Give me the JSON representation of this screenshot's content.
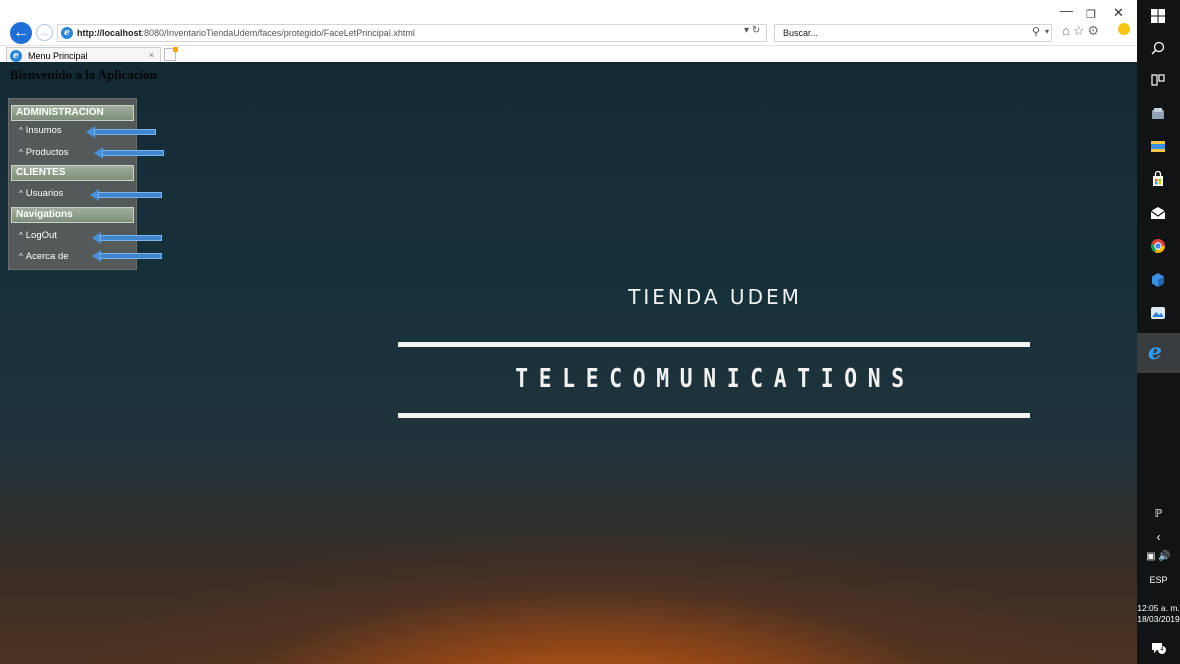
{
  "browser": {
    "url_host": "http://localhost",
    "url_rest": ":8080/InventarioTiendaUdem/faces/protegido/FaceLetPrincipal.xhtml",
    "search_placeholder": "Buscar...",
    "tab_title": "Menu Principal",
    "tab_close": "×"
  },
  "page": {
    "welcome": "Bienvenido a la Aplicacion",
    "menu": [
      {
        "header": "ADMINISTRACION",
        "items": [
          "Insumos",
          "Productos"
        ]
      },
      {
        "header": "CLIENTES",
        "items": [
          "Usuarios"
        ]
      },
      {
        "header": "Navigations",
        "items": [
          "LogOut",
          "Acerca de"
        ]
      }
    ],
    "logo_title": "TIENDA UDEM",
    "logo_subtitle": "TELECOMUNICATIONS"
  },
  "taskbar": {
    "language": "ESP",
    "time": "12:05 a. m.",
    "date": "18/03/2019",
    "notification_count": "4"
  },
  "colors": {
    "accent": "#1f6fd6",
    "arrow": "#3f86cf",
    "menu_header": "#8d9d89",
    "sunset": "#d66816",
    "sky": "#132a35"
  }
}
